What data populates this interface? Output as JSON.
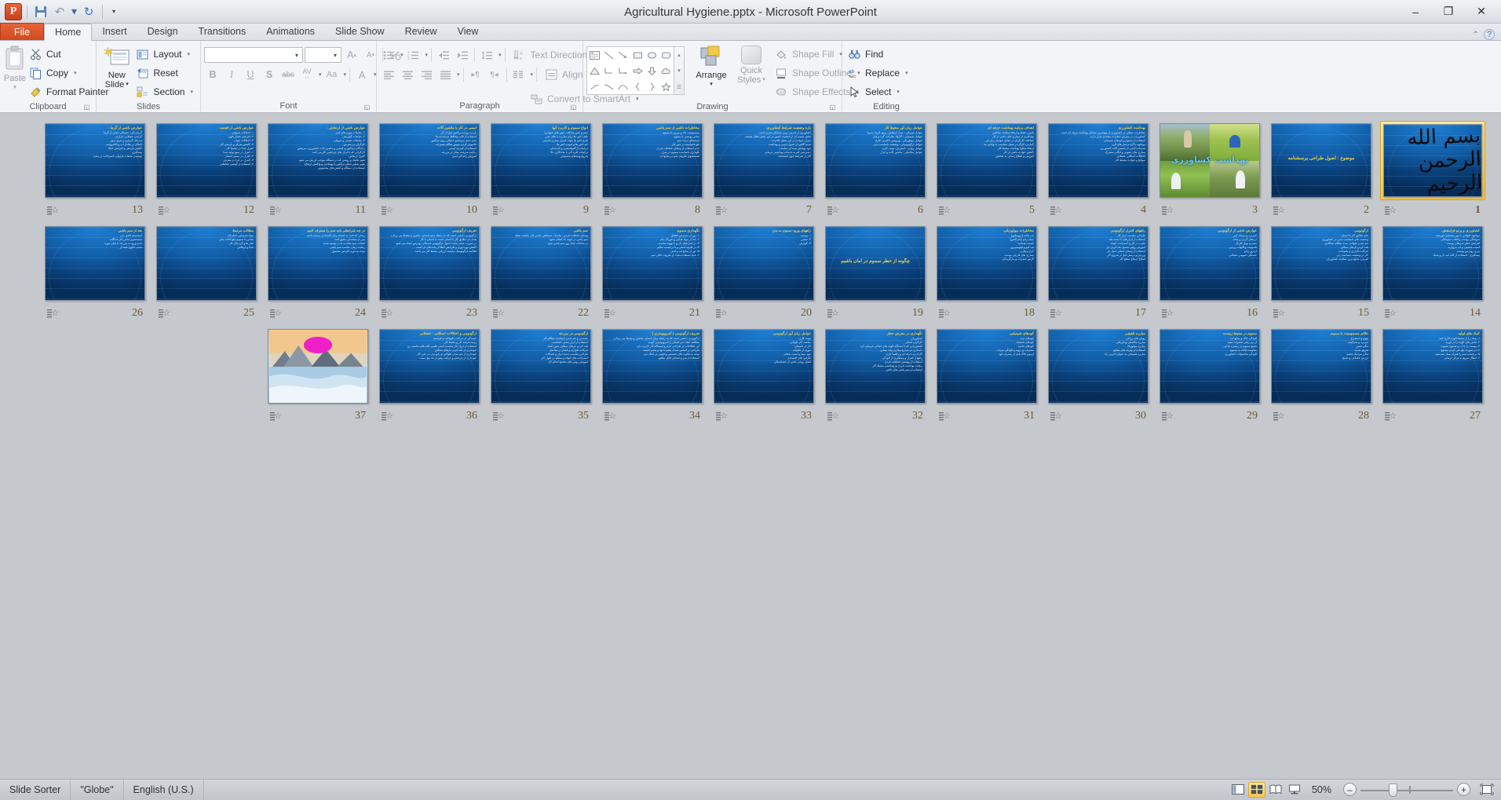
{
  "window": {
    "title": "Agricultural Hygiene.pptx - Microsoft PowerPoint",
    "minimize": "–",
    "maximize": "❐",
    "close": "✕",
    "help": "?",
    "ribbon_toggle": "⌃"
  },
  "quick_access": {
    "app_button": "P",
    "save": "Save",
    "undo": "Undo",
    "undo_caret": "▾",
    "redo": "Redo",
    "customize": "▾"
  },
  "tabs": [
    {
      "label": "File",
      "active": false,
      "file": true
    },
    {
      "label": "Home",
      "active": true
    },
    {
      "label": "Insert",
      "active": false
    },
    {
      "label": "Design",
      "active": false
    },
    {
      "label": "Transitions",
      "active": false
    },
    {
      "label": "Animations",
      "active": false
    },
    {
      "label": "Slide Show",
      "active": false
    },
    {
      "label": "Review",
      "active": false
    },
    {
      "label": "View",
      "active": false
    }
  ],
  "ribbon": {
    "clipboard": {
      "label": "Clipboard",
      "paste": "Paste",
      "paste_caret": "▾",
      "cut": "Cut",
      "copy": "Copy",
      "copy_caret": "▾",
      "format_painter": "Format Painter"
    },
    "slides": {
      "label": "Slides",
      "new_slide": "New\nSlide",
      "new_slide_line1": "New",
      "new_slide_line2": "Slide",
      "new_slide_caret": "▾",
      "layout": "Layout",
      "reset": "Reset",
      "section": "Section",
      "caret": "▾"
    },
    "font": {
      "label": "Font",
      "font_name": "",
      "font_size": "",
      "grow_font": "A",
      "shrink_font": "A",
      "clear_formatting": "Aa",
      "bold": "B",
      "italic": "I",
      "underline": "U",
      "shadow": "S",
      "strikethrough": "abc",
      "char_spacing": "AV",
      "change_case": "Aa",
      "font_color": "A",
      "caret": "▾"
    },
    "paragraph": {
      "label": "Paragraph",
      "bullets": "Bullets",
      "numbering": "Numbering",
      "decrease_indent": "Decrease List Level",
      "increase_indent": "Increase List Level",
      "line_spacing": "Line Spacing",
      "align_left": "Align Text Left",
      "align_center": "Center",
      "align_right": "Align Text Right",
      "justify": "Justify",
      "ltr": "Left-to-Right",
      "rtl": "Right-to-Left",
      "columns": "Columns",
      "text_direction": "Text Direction",
      "align_text": "Align Text",
      "convert_smartart": "Convert to SmartArt",
      "caret": "▾"
    },
    "drawing": {
      "label": "Drawing",
      "shapes": [
        "textbox",
        "line",
        "arrow",
        "rectangle",
        "oval",
        "rounded-rect",
        "triangle",
        "elbow-connector",
        "elbow-arrow-connector",
        "block-arrow-right",
        "block-arrow-down",
        "cloud-callout",
        "scribble",
        "curve-arc",
        "arc",
        "left-brace",
        "right-brace",
        "star"
      ],
      "gallery_up": "▴",
      "gallery_down": "▾",
      "gallery_more": "▾",
      "arrange": "Arrange",
      "arrange_caret": "▾",
      "quick_styles_line1": "Quick",
      "quick_styles_line2": "Styles",
      "quick_styles_caret": "▾",
      "shape_fill": "Shape Fill",
      "shape_outline": "Shape Outline",
      "shape_effects": "Shape Effects"
    },
    "editing": {
      "label": "Editing",
      "find": "Find",
      "replace": "Replace",
      "select": "Select",
      "caret": "▾"
    }
  },
  "status_bar": {
    "view_name": "Slide Sorter",
    "theme": "\"Globe\"",
    "language": "English (U.S.)",
    "zoom_percent": "50%",
    "zoom_out": "–",
    "zoom_in": "+",
    "views": [
      {
        "name": "normal-view",
        "active": false
      },
      {
        "name": "slide-sorter-view",
        "active": true
      },
      {
        "name": "reading-view",
        "active": false
      },
      {
        "name": "slide-show-view",
        "active": false
      }
    ],
    "fit_to_window": "Fit slide to current window"
  },
  "slide_sorter": {
    "total_slides": 37,
    "selected_slide": 1,
    "slides": [
      {
        "number": 1,
        "type": "calligraphy",
        "selected": true,
        "calligraphy": "بسم الله الرحمن الرحیم",
        "title": "",
        "lines": []
      },
      {
        "number": 2,
        "type": "text",
        "title": "موضوع : اصول طراحی پرسشنامه",
        "lines": []
      },
      {
        "number": 3,
        "type": "photos",
        "caption": "بهداشت کشاورزی",
        "title": "",
        "lines": []
      },
      {
        "number": 4,
        "type": "text",
        "title": "بهداشت کشاورزی",
        "lines": [
          "مخاطرات شغلی در کشاورزی از مهمترین مسائل بهداشت حرفه ای است",
          "کشاورزان در معرض خطرات متعددی قرار دارند",
          "استفاده از سموم و کودهای شیمیایی",
          "مواجهه با گرد و غبار های آلی",
          "صدمات ناشی از ماشین آلات کشاورزی",
          "بیماری های عفونی و انگلی مشترک",
          "اختلالات اسکلتی عضلانی",
          "سوانح و حوادث محیط کار"
        ]
      },
      {
        "number": 5,
        "type": "text",
        "title": "اهداف برنامه بهداشت حرفه ای",
        "lines": [
          "تامین، حفظ و ارتقاء سلامت شاغلین",
          "پیشگیری از بیماری های ناشی از کار",
          "حفاظت کارگران در مقابل عوامل زیان آور",
          "گماردن کارگر در شغل متناسب با توانایی ها",
          "ارتقاء سطح بهداشت محیط کار",
          "کاهش حوادث ناشی از کار",
          "آموزش و اطلاع رسانی به شاغلین"
        ]
      },
      {
        "number": 6,
        "type": "text",
        "title": "عوامل زیان آور محیط کار",
        "lines": [
          "عوامل فیزیکی : صدا، ارتعاش، پرتو، گرما، سرما",
          "عوامل شیمیایی : گازها، بخارات، گرد و غبار",
          "عوامل بیولوژیکی : ویروس، باکتری، قارچ",
          "عوامل ارگونومیکی : وضعیت نامناسب بدن",
          "عوامل روانی : استرس، نوبت کاری",
          "عوامل مکانیکی : ماشین آلات و ابزار"
        ]
      },
      {
        "number": 7,
        "type": "text",
        "title": "بازه وضعیت شرایط کشاورزی",
        "lines": [
          "کشاورزی از قدیمی ترین مشاغل بشری است",
          "بخش عمده ای از جمعیت کشور در این بخش فعال هستند",
          "میزان حوادث در این شغل بالاست",
          "عدم آگاهی از اصول ایمنی و بهداشت",
          "نبود پوشش بیمه ای مناسب",
          "دسترسی کم به خدمات بهداشتی درمانی",
          "کار در شرایط جوی نامساعد"
        ]
      },
      {
        "number": 8,
        "type": "text",
        "title": "مخاطرات ناشی از سم پاشی",
        "lines": [
          "مسمومیت حاد و مزمن با سموم",
          "تماس پوستی با سموم",
          "استنشاق ذرات سم",
          "بلع ناخواسته در حین کار",
          "عدم استفاده از وسایل حفاظت فردی",
          "نگهداری نامناسب سموم در منزل",
          "شستشوی ظروف سم در منابع آب"
        ]
      },
      {
        "number": 9,
        "type": "text",
        "title": "انواع سموم و کاربرد آنها",
        "lines": [
          "حشره کش ها (آفت کش های حیوانی)",
          "علف کش ها برای مبارزه با علف هرز",
          "قارچ کش ها جهت کنترل بیماری قارچی",
          "کنه کش ها و جونده کش ها",
          "ترکیبات ارگانوفسفره و کارباماتی",
          "ترکیبات کلره آلی با ماندگاری بالا",
          "پایروتروئیدهای مصنوعی"
        ]
      },
      {
        "number": 10,
        "type": "text",
        "title": "ایمنی در کار با ماشین آلات",
        "lines": [
          "بازدید روزانه تراکتور قبل از کار",
          "استفاده از قاب محافظ چرخدنده ها",
          "عدم حمل سرنشین اضافی روی تراکتور",
          "خاموش کردن موتور هنگام تعمیرات",
          "استفاده از کمربند ایمنی",
          "رعایت سرعت مجاز در مزرعه",
          "آموزش رانندگی ایمن"
        ]
      },
      {
        "number": 11,
        "type": "text",
        "title": "عوارض ناشی از ارتعاش :",
        "lines": [
          "۱- ضایعات مهره های کمر",
          "۲- ضایعات گوارشی",
          "۳- ضایعات عصبی و عروقی",
          "کارگران در معرض :",
          "رانندگان تراکتور و کمباین و ماشین آلات کشاورزی، مرتعش",
          "کارگرانی که با ابزار های چرخشی کار می کنند",
          "کنترل ارتعاش :",
          "تغییر تکنیک و روشی که در دستگاه موجب لرزش می شود",
          "تغییر عملی شکل تراکتور با پوشاندن و واکنش ارتجاع",
          "استفاده از دستگاه و کفش های مخصوص"
        ]
      },
      {
        "number": 12,
        "type": "text",
        "title": "عوارض ناشی از قفسه :",
        "lines": [
          "۱- اختلالات شنوایی",
          "۲- افزایش فشار خون",
          "۳- اختلالات خواب",
          "۴- کاهش تمرکز و بازدهی کار",
          "کنترل صدا در محیط کار :",
          "۱- کنترل در منبع تولید صدا",
          "۲- کنترل در مسیر انتشار",
          "۳- کنترل در فرد در معرض",
          "۴- استفاده از گوشی حفاظتی"
        ]
      },
      {
        "number": 13,
        "type": "text",
        "title": "عوارض ناشی از گرما :",
        "lines": [
          "گرمازدگی، خستگی ناشی از گرما",
          "کرامپ عضلانی حرارتی",
          "سرخک گرمایی و عرق سوز",
          "اختلال در تعادل آب و الکترولیت",
          "کاهش بازدهی و افزایش خطا",
          "پیشگیری :",
          "نوشیدن مایعات فراوان، استراحت در سایه"
        ]
      },
      {
        "number": 14,
        "type": "text",
        "title": "کشاورزی و پرتو فرابنفش",
        "lines": [
          "مواجهه طولانی با نور مستقیم خورشید",
          "سوختگی پوست و آفتاب سوختگی",
          "افزایش خطر سرطان پوست",
          "آسیب چشمی و آب مروارید",
          "پیری زودرس پوست",
          "پیشگیری : استفاده از کلاه لبه دار و عینک"
        ]
      },
      {
        "number": 15,
        "type": "text",
        "title": "ارگونومی",
        "lines": [
          "علم تطابق کار با انسان",
          "وضعیت های نامناسب بدنی در کشاورزی",
          "خم شدن طولانی مدت هنگام نشاکاری",
          "بلند کردن بارهای سنگین",
          "حرکات تکراری و یکنواخت",
          "کار در وضعیت چمباتمه زدن",
          "کمردرد شایع ترین شکایت کشاورزان"
        ]
      },
      {
        "number": 16,
        "type": "text",
        "title": "عوارض ناشی از ارگونومی",
        "lines": [
          "کمردرد و دیسک کمر",
          "دردهای گردن و شانه",
          "سندرم تونل کارپال",
          "تاندونیت و التهاب زردپی",
          "آرتروز زانو",
          "خستگی عمومی عضلانی"
        ]
      },
      {
        "number": 17,
        "type": "text",
        "title": "راههای کنترل ارگونومی",
        "lines": [
          "طراحی مناسب ابزار کار",
          "استفاده از ابزارهای با دسته بلند",
          "تناوب در کار و استراحت کوتاه",
          "آموزش روش صحیح بلند کردن بار",
          "استفاده از وسایل کمکی حمل بار",
          "ورزش و نرمش قبل از شروع کار",
          "اصلاح ارتفاع سطح کار"
        ]
      },
      {
        "number": 18,
        "type": "text",
        "title": "مخاطرات بیولوژیکی",
        "lines": [
          "تب مالت (بروسلوز)",
          "سیاه زخم (آنتراکس)",
          "کیست هیداتید",
          "تب کیو و لپتوسپیروز",
          "کزاز و هاری",
          "بیماری های قارچی پوست",
          "گزش حشرات و مارگزیدگی"
        ]
      },
      {
        "number": 19,
        "type": "text",
        "title": "چگونه از خطر سموم در امان باشیم",
        "lines": []
      },
      {
        "number": 20,
        "type": "text",
        "title": "راههای ورود سموم به بدن",
        "lines": [
          "۱- پوست",
          "۲- تنفس",
          "۳- گوارش"
        ]
      },
      {
        "number": 21,
        "type": "text",
        "title": "نگهداری سموم",
        "lines": [
          "۱- دور از دسترس اطفال",
          "۲- جدا از مواد غذایی و خوراک دام",
          "۳- در انبار قفل دار و با تهویه مناسب",
          "۴- در ظرف اصلی و با برچسب سالم",
          "۵- دور از منابع آب و آتش",
          "۶- عدم استفاده مجدد از ظروف خالی سم"
        ]
      },
      {
        "number": 22,
        "type": "text",
        "title": "سم پاشی",
        "lines": [
          "وسایل حفاظت فردی : ماسک، دستکش، لباس کار، چکمه، عینک",
          "سم پاشی در جهت باد انجام نشود",
          "در ساعات خنک روز سم پاشی شود"
        ]
      },
      {
        "number": 23,
        "type": "text",
        "title": "تعریف ارگونومی",
        "lines": [
          "ارگونومی دانشی است که به رابطه میان انسان، ماشین و محیط می پردازد",
          "هدف آن تطابق کار با انسان است نه انسان با کار",
          "در صورت عدم رعایت اصول ارگونومی خستگی زودرس ایجاد می شود",
          "کاهش بهره وری و افزایش خطا از پیامدهای آن است",
          "فعالیت ارگونومیک نیازمند ارزیابی محیط کار می باشد"
        ]
      },
      {
        "number": 24,
        "type": "text",
        "title": "در چه شرایطی باید سم را مصرف کنیم",
        "lines": [
          "زمانی که آفت به آستانه زیان اقتصادی رسیده باشد",
          "پس از شناسایی دقیق آفت",
          "انتخاب سم مناسب با دز توصیه شده",
          "رعایت زمان مناسب سم پاشی",
          "توجه به دوره کارنس محصول"
        ]
      },
      {
        "number": 25,
        "type": "text",
        "title": "مطالب مرتبط",
        "lines": [
          "مواد شیمیایی خطرناک",
          "تماس با سموم دفع آفات نباتی",
          "غبار ها و گرد های آلی",
          "صدا و ارتعاش"
        ]
      },
      {
        "number": 26,
        "type": "text",
        "title": "بعد از سم پاشی",
        "lines": [
          "استحمام کامل بدن",
          "شستشوی لباس کار جداگانه",
          "عدم ورود به مزرعه تا پایان دوره",
          "نصب تابلوی هشدار"
        ]
      },
      {
        "number": 27,
        "type": "text",
        "title": "کمک های اولیه",
        "lines": [
          "۱- بیمار را از محیط آلوده خارج کنید",
          "۲- لباس های آلوده را در آورید",
          "۳- پوست را با آب و صابون بشویید",
          "۴- در صورت بلع، قی کردن ممنوع",
          "۵- برچسب سم را همراه بیمار بفرستید",
          "۶- انتقال سریع به مرکز درمانی"
        ]
      },
      {
        "number": 28,
        "type": "text",
        "title": "علائم مسمومیت با سموم",
        "lines": [
          "تهوع و استفراغ",
          "سردرد و سرگیجه",
          "تنگی نفس",
          "تعریق شدید",
          "تنگی مردمک چشم",
          "لرزش عضلانی و تشنج"
        ]
      },
      {
        "number": 29,
        "type": "text",
        "title": "سموم در محیط زیست",
        "lines": [
          "آلودگی خاک و منابع آب",
          "از بین رفتن حشرات مفید",
          "تجمع سموم در زنجیره غذایی",
          "مقاومت آفات به سموم",
          "آلودگی محصولات کشاورزی"
        ]
      },
      {
        "number": 30,
        "type": "text",
        "title": "مبارزه تلفیقی",
        "lines": [
          "روش های زراعی",
          "مبارزه مکانیکی و فیزیکی",
          "مبارزه بیولوژیک",
          "استفاده از واریته های مقاوم",
          "مبارزه شیمیایی به عنوان آخرین راه"
        ]
      },
      {
        "number": 31,
        "type": "text",
        "title": "کودهای شیمیایی",
        "lines": [
          "کودهای ازته",
          "کودهای فسفاته",
          "کودهای پتاسه",
          "مصرف بی رویه و آلودگی نیترات",
          "آزمون خاک قبل از مصرف کود"
        ]
      },
      {
        "number": 32,
        "type": "text",
        "title": "نگهداری در معرض خطر",
        "lines": [
          "کشاورزان",
          "کارگران فصلی",
          "کشاورزانی که با دستگاه آلوده های خیابان حریمان کرد",
          "دامداری در مزارع بیماری ولیه بیماری",
          "کارکردن حرفه ای و راهنما داری",
          "راههای کنترل و پیشگیری از آلودگی",
          "استفاده از پوشش حفاظت فردی",
          "رعایت بهداشت فردی و بهداشتی محیط کار",
          "استفاده از سم پاشی های خاص"
        ]
      },
      {
        "number": 33,
        "type": "text",
        "title": "عوامل زیان آور ارگونومی",
        "lines": [
          "نوبت کاری",
          "ساعت کار طولانی",
          "کار در تابستان",
          "دوری از خانواده",
          "نبود بیمه و امنیت شغلی",
          "نگرانی های اقتصادی",
          "فشار روحی ناشی از خشکسالی"
        ]
      },
      {
        "number": 34,
        "type": "text",
        "title": "تعریف ارگونومی ( آنتروپومتری )",
        "lines": [
          "ارگونومی دانشی است که به رابطه میان انسان، ماشین و محیط می پردازد",
          "مطالعه ابعاد بدن انسان را آنتروپومتری گویند",
          "این اطلاعات در طراحی ابزار و ایستگاه کار کاربرد دارد",
          "طراحی بر اساس صدک پنجم تا نود و پنجم جامعه",
          "توجه به تفاوت های جنسیتی و قومی در ابعاد بدن",
          "استفاده از میز و صندلی قابل تنظیم"
        ]
      },
      {
        "number": 35,
        "type": "text",
        "title": "ارگونومی در مزرعه",
        "lines": [
          "نشستن و خم شدن نامناسب هنگام کار",
          "استفاده از ابزار دستی نامناسب",
          "بلند کردن بارهای سنگین بدون کمک",
          "حرکات تکراری و فشار بر مفاصل",
          "طراحی مناسب دسته ابزار و اتصالات",
          "استراحت های کوتاه و منظم در طول کار",
          "آموزش روش های صحیح انجام کار"
        ]
      },
      {
        "number": 36,
        "type": "text",
        "title": "ارگونومی و اختلالات اسکلتی - عضلانی",
        "lines": [
          "خمیدگی از حرکات یکنواخت و فزاینده",
          "زمینه فرایند کار و محیط کار",
          "استفاده از ابزار کار مناسب است علمی نکته های مناسب تن",
          "خودداری از بلند کردن بارهای سنگین",
          "خودداری از خم شدن طولانی و زانو زدن در حین کار",
          "خودداری از چرخش و حرکت پیش از حد مچ دست"
        ]
      },
      {
        "number": 37,
        "type": "mountain",
        "title": "",
        "lines": []
      }
    ]
  }
}
